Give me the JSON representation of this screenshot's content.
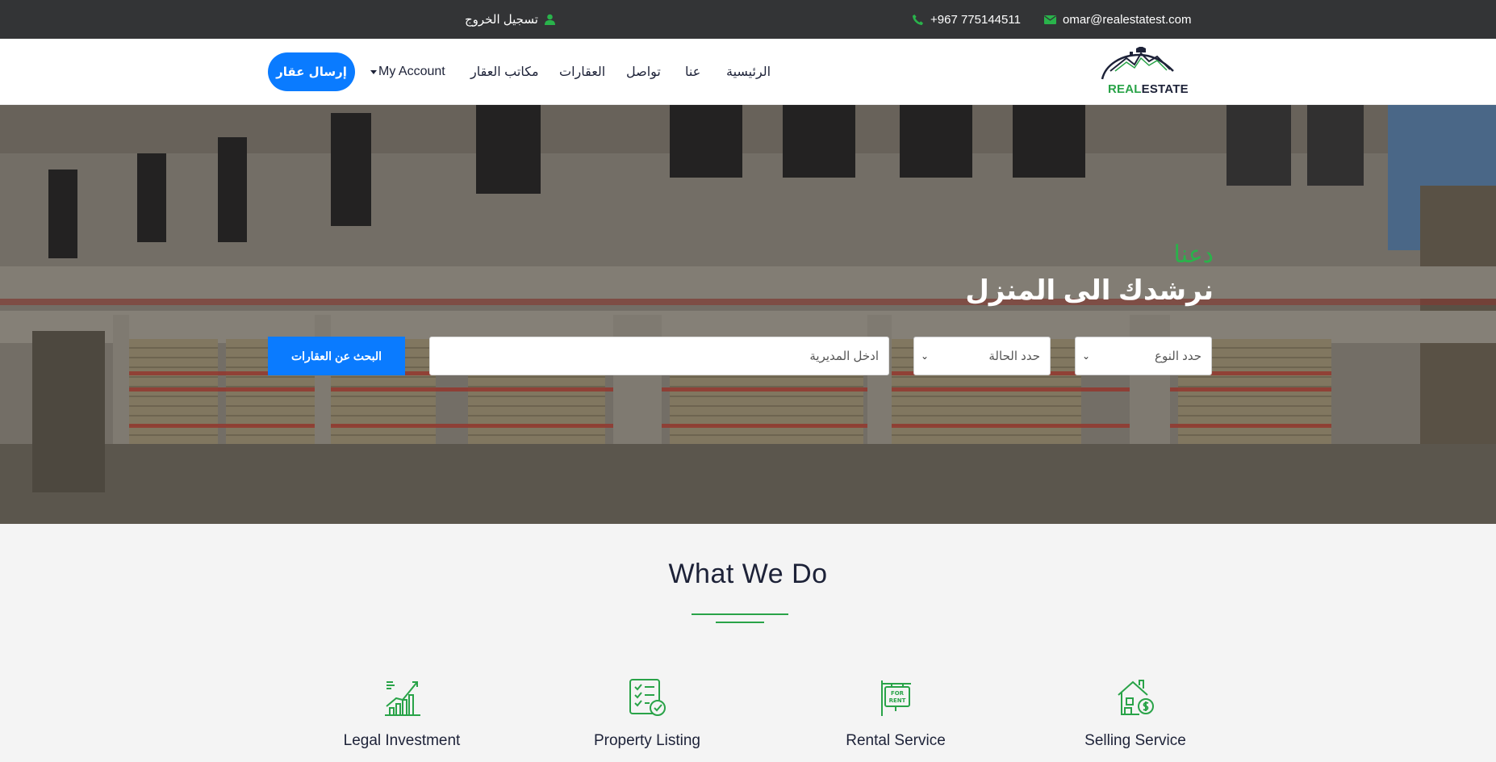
{
  "topbar": {
    "logout_label": "تسجيل الخروج",
    "phone": "+967 775144511",
    "email": "omar@realestatest.com"
  },
  "brand": {
    "logo_part1": "REAL",
    "logo_part2": "ESTATE"
  },
  "nav": {
    "items": [
      {
        "label": "الرئيسية"
      },
      {
        "label": "عنا"
      },
      {
        "label": "تواصل"
      },
      {
        "label": "العقارات"
      },
      {
        "label": "مكاتب العقار"
      },
      {
        "label": "My Account"
      }
    ],
    "submit_label": "إرسال عقار"
  },
  "hero": {
    "kicker": "دعنا",
    "headline": "نرشدك الى المنزل",
    "type_select": "حدد النوع",
    "status_select": "حدد الحالة",
    "district_placeholder": "ادخل المديرية",
    "search_button": "البحث عن العقارات"
  },
  "section": {
    "title": "What We Do",
    "services": [
      {
        "label": "Legal Investment",
        "icon": "growth-chart-icon"
      },
      {
        "label": "Property Listing",
        "icon": "checklist-icon"
      },
      {
        "label": "Rental Service",
        "icon": "for-rent-sign-icon"
      },
      {
        "label": "Selling Service",
        "icon": "house-money-icon"
      }
    ]
  },
  "colors": {
    "accent_green": "#29a348",
    "primary_blue": "#0a7bff",
    "topbar_bg": "#333436",
    "heading_navy": "#1d2238"
  }
}
